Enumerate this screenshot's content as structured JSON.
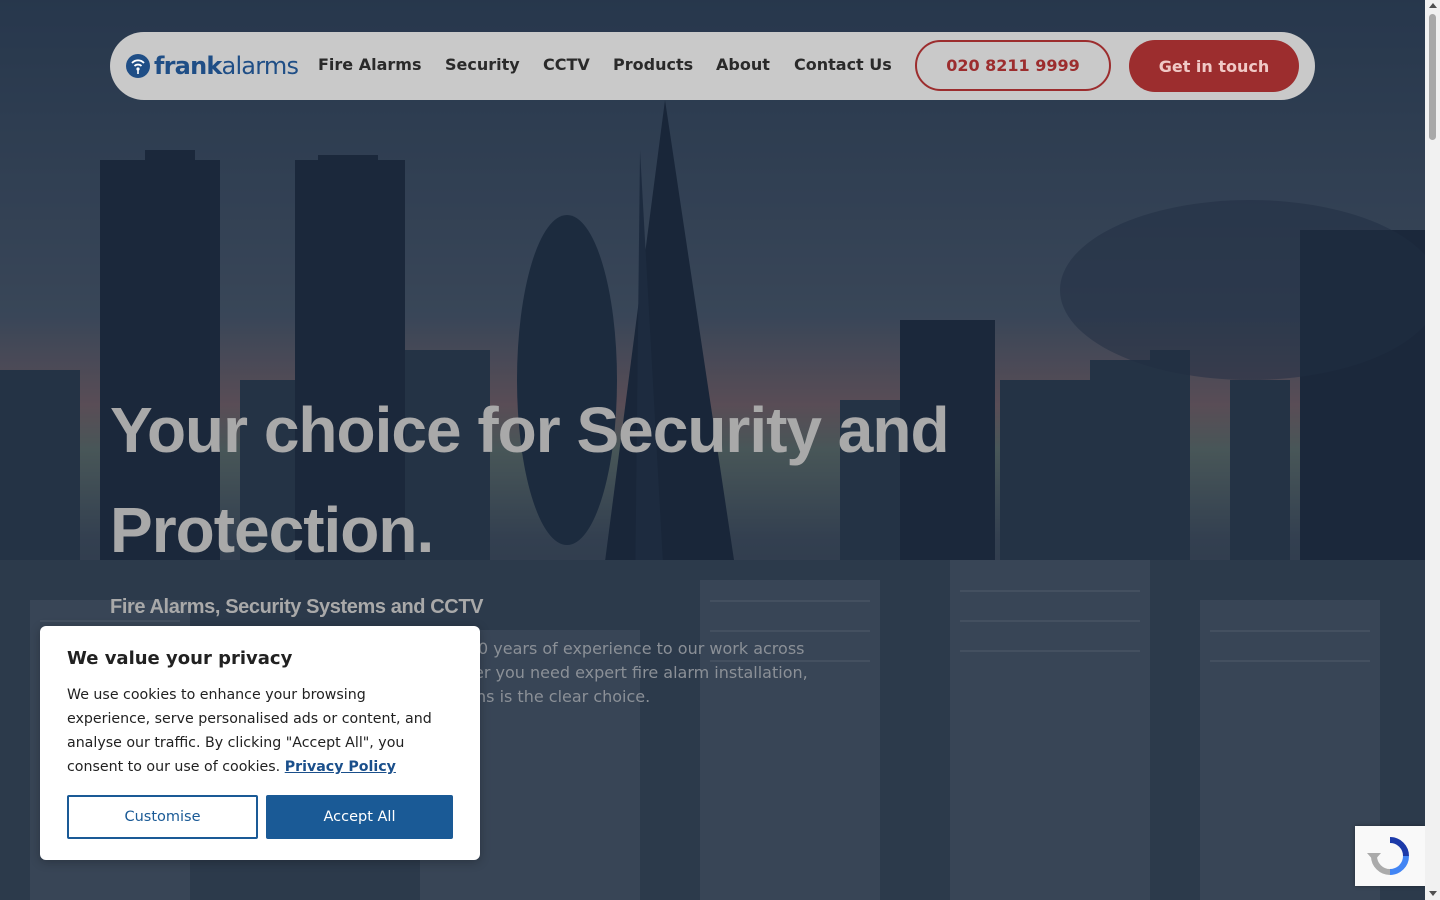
{
  "brand": {
    "logo_icon": "frank-alarms-signal-icon",
    "logo_text_bold": "frank",
    "logo_text_regular": "alarms",
    "brand_color": "#1f4e86",
    "accent_color": "#9c2d2e"
  },
  "nav": {
    "items": [
      {
        "label": "Fire Alarms"
      },
      {
        "label": "Security"
      },
      {
        "label": "CCTV"
      },
      {
        "label": "Products"
      },
      {
        "label": "About"
      },
      {
        "label": "Contact Us"
      }
    ],
    "phone": "020 8211 9999",
    "cta": "Get in touch"
  },
  "hero": {
    "headline_line1": "Your choice for Security and",
    "headline_line2": "Protection.",
    "subheadline": "Fire Alarms, Security Systems and CCTV",
    "intro_line1": "0 years of experience to our work across",
    "intro_line2": "er you need expert fire alarm installation,",
    "intro_line3": "ns is the clear choice."
  },
  "cookie_banner": {
    "title": "We value your privacy",
    "body": "We use cookies to enhance your browsing experience, serve personalised ads or content, and analyse our traffic. By clicking \"Accept All\", you consent to our use of cookies.",
    "policy_link": "Privacy Policy",
    "customise_label": "Customise",
    "accept_label": "Accept All"
  },
  "recaptcha": {
    "icon": "recaptcha-icon"
  }
}
